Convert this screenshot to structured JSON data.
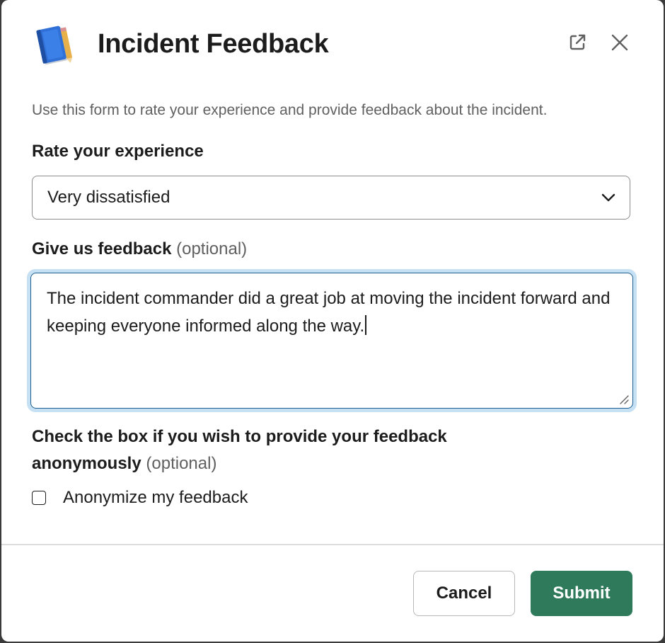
{
  "modal": {
    "title": "Incident Feedback",
    "app_icon": "notebook-icon",
    "header_actions": [
      "popout-icon",
      "close-icon"
    ]
  },
  "form": {
    "intro": "Use this form to rate your experience and provide feedback about the incident.",
    "rating": {
      "label": "Rate your experience",
      "selected_value": "Very dissatisfied"
    },
    "feedback": {
      "label": "Give us feedback",
      "optional_suffix": "(optional)",
      "value": "The incident commander did a great job at moving the incident forward and keeping everyone informed along the way."
    },
    "anonymous": {
      "label": "Check the box if you wish to provide your feedback anonymously",
      "optional_suffix": "(optional)",
      "checkbox_label": "Anonymize my feedback",
      "checked": false
    }
  },
  "footer": {
    "cancel_label": "Cancel",
    "submit_label": "Submit"
  },
  "colors": {
    "submit_bg": "#2e7a5b",
    "focus_ring": "#c6e1f3",
    "focus_border": "#1d5e92",
    "muted_text": "#616061"
  }
}
